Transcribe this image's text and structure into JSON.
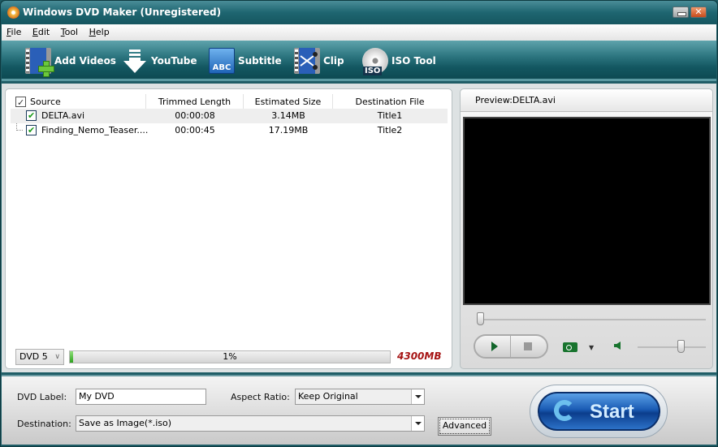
{
  "window": {
    "title": "Windows DVD Maker (Unregistered)",
    "minimize_glyph": "—",
    "close_glyph": "✕"
  },
  "menu": [
    {
      "label": "File",
      "accel": "F",
      "rest": "ile"
    },
    {
      "label": "Edit",
      "accel": "E",
      "rest": "dit"
    },
    {
      "label": "Tool",
      "accel": "T",
      "rest": "ool"
    },
    {
      "label": "Help",
      "accel": "H",
      "rest": "elp"
    }
  ],
  "toolbar": {
    "add_videos": "Add Videos",
    "youtube": "YouTube",
    "subtitle": "Subtitle",
    "subtitle_icon_text": "ABC",
    "clip": "Clip",
    "iso_tool": "ISO Tool",
    "iso_icon_text": "ISO"
  },
  "file_list": {
    "columns": [
      "Source",
      "Trimmed Length",
      "Estimated Size",
      "Destination File"
    ],
    "rows": [
      {
        "source": "DELTA.avi",
        "length": "00:00:08",
        "size": "3.14MB",
        "dest": "Title1",
        "checked": true
      },
      {
        "source": "Finding_Nemo_Teaser....",
        "length": "00:00:45",
        "size": "17.19MB",
        "dest": "Title2",
        "checked": true
      }
    ]
  },
  "disc": {
    "type": "DVD 5",
    "usage_percent": 1,
    "usage_label": "1%",
    "capacity": "4300MB"
  },
  "preview": {
    "title": "Preview:DELTA.avi",
    "seek_position": 0,
    "volume": 0.65
  },
  "options": {
    "dvd_label_label": "DVD Label:",
    "dvd_label_value": "My DVD",
    "aspect_ratio_label": "Aspect Ratio:",
    "aspect_ratio_value": "Keep Original",
    "destination_label": "Destination:",
    "destination_value": "Save as Image(*.iso)",
    "advanced_button": "Advanced",
    "start_button": "Start"
  }
}
